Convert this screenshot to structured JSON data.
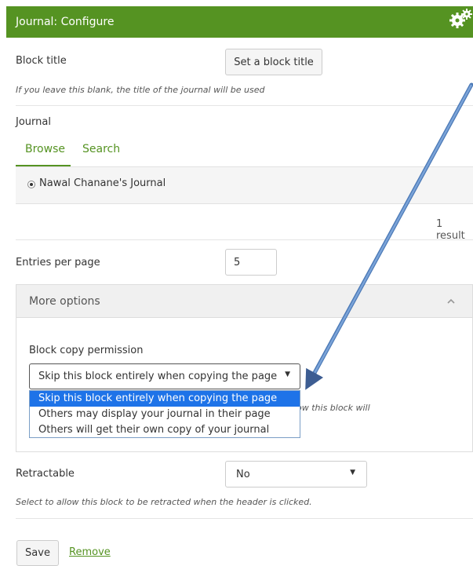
{
  "header": {
    "title": "Journal: Configure",
    "gear_icon": "gears-icon",
    "color": "#559322"
  },
  "block_title": {
    "label": "Block title",
    "button": "Set a block title",
    "help": "If you leave this blank, the title of the journal will be used"
  },
  "journal": {
    "label": "Journal",
    "tabs": [
      {
        "label": "Browse"
      },
      {
        "label": "Search"
      }
    ],
    "selected": "Nawal Chanane's Journal",
    "results": "1 result"
  },
  "entries": {
    "label": "Entries per page",
    "value": "5"
  },
  "more_options": {
    "title": "More options",
    "copy_permission": {
      "label": "Block copy permission",
      "selected": "Skip this block entirely when copying the page",
      "options": [
        "Skip this block entirely when copying the page",
        "Others may display your journal in their page",
        "Others will get their own copy of your journal"
      ],
      "help_partial": "ow this block will"
    }
  },
  "retractable": {
    "label": "Retractable",
    "value": "No",
    "help": "Select to allow this block to be retracted when the header is clicked."
  },
  "actions": {
    "save": "Save",
    "remove": "Remove"
  }
}
